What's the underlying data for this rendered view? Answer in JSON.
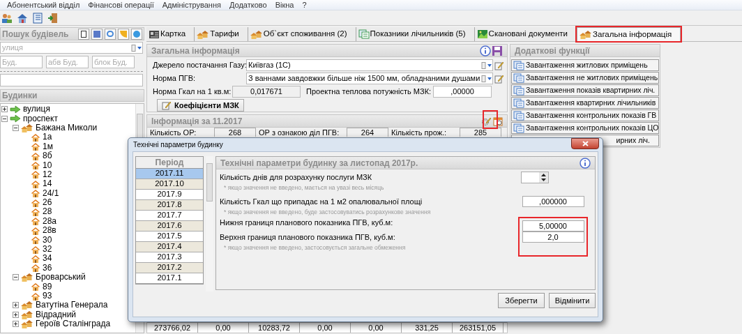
{
  "menu": [
    "Абонентський відділ",
    "Фінансові операції",
    "Адміністрування",
    "Додатково",
    "Вікна",
    "?"
  ],
  "search_panel": {
    "title": "Пошук будівель",
    "street": {
      "placeholder": "улиця"
    },
    "fields": [
      {
        "placeholder": "Буд."
      },
      {
        "placeholder": "абв Буд."
      },
      {
        "placeholder": "блок Буд."
      }
    ],
    "tree_title": "Будинки",
    "tree": [
      {
        "label": "вулиця",
        "kind": "street",
        "expanded": false
      },
      {
        "label": "проспект",
        "kind": "street",
        "expanded": true,
        "children": [
          {
            "label": "Бажана Миколи",
            "kind": "group",
            "expanded": true,
            "children": [
              {
                "label": "1а",
                "kind": "house"
              },
              {
                "label": "1м",
                "kind": "house"
              },
              {
                "label": "8б",
                "kind": "house"
              },
              {
                "label": "10",
                "kind": "house"
              },
              {
                "label": "12",
                "kind": "house"
              },
              {
                "label": "14",
                "kind": "house"
              },
              {
                "label": "24/1",
                "kind": "house"
              },
              {
                "label": "26",
                "kind": "house"
              },
              {
                "label": "28",
                "kind": "house"
              },
              {
                "label": "28а",
                "kind": "house"
              },
              {
                "label": "28в",
                "kind": "house"
              },
              {
                "label": "30",
                "kind": "house"
              },
              {
                "label": "32",
                "kind": "house"
              },
              {
                "label": "34",
                "kind": "house"
              },
              {
                "label": "36",
                "kind": "house"
              }
            ]
          },
          {
            "label": "Броварський",
            "kind": "group",
            "expanded": true,
            "children": [
              {
                "label": "89",
                "kind": "house"
              },
              {
                "label": "93",
                "kind": "house"
              }
            ]
          },
          {
            "label": "Ватутіна Генерала",
            "kind": "group",
            "expanded": false
          },
          {
            "label": "Відрадний",
            "kind": "group",
            "expanded": false
          },
          {
            "label": "Героїв Сталінграда",
            "kind": "group",
            "expanded": false
          }
        ]
      }
    ]
  },
  "tabs": [
    {
      "label": "Картка",
      "selected": false,
      "highlighted": false
    },
    {
      "label": "Тарифи",
      "selected": false,
      "highlighted": false
    },
    {
      "label": "Об`єкт споживання (2)",
      "selected": false,
      "highlighted": false
    },
    {
      "label": "Показники лічильників (5)",
      "selected": false,
      "highlighted": false
    },
    {
      "label": "Скановані документи",
      "selected": false,
      "highlighted": false
    },
    {
      "label": "Загальна інформація",
      "selected": true,
      "highlighted": true
    }
  ],
  "general_info": {
    "title": "Загальна інформація",
    "gas_source": {
      "label": "Джерело постачання Газу:",
      "value": "Київгаз (1С)"
    },
    "pgv_norm": {
      "label": "Норма ПГВ:",
      "value": "З ваннами завдовжки більше ніж 1500 мм, обладнаними душами"
    },
    "gcal_norm": {
      "label": "Норма Гкал на 1 кв.м:",
      "value": "0,017671"
    },
    "design_power": {
      "label": "Проектна теплова потужність МЗК:",
      "value": ",00000"
    },
    "button": "Коефіцієнти МЗК"
  },
  "period_info": {
    "title": "Інформація за 11.2017",
    "settings_highlighted": true,
    "row": [
      {
        "label": "Кількість ОР:",
        "value": "268"
      },
      {
        "label": "ОР з ознакою діл ПГВ:",
        "value": "264"
      },
      {
        "label": "Кількість прож.:",
        "value": "285"
      }
    ],
    "totals": [
      "273766,02",
      "0,00",
      "10283,72",
      "0,00",
      "0,00",
      "331,25",
      "263151,05"
    ]
  },
  "extra_functions": {
    "title": "Додаткові функції",
    "buttons": [
      "Завантаження житлових приміщень",
      "Завантаження не житлових приміщень",
      "Завантаження показів квартирних ліч.",
      "Завантаження квартирних лічильників",
      "Завантаження контрольних показів ГВ",
      "Завантаження контрольних показів ЦО",
      "ирних ліч."
    ]
  },
  "dialog": {
    "title": "Технічні параметри будинку",
    "periods_header": "Період",
    "periods": [
      {
        "label": "2017.11",
        "selected": true
      },
      {
        "label": "2017.10",
        "selected": false
      },
      {
        "label": "2017.9",
        "selected": false
      },
      {
        "label": "2017.8",
        "selected": false
      },
      {
        "label": "2017.7",
        "selected": false
      },
      {
        "label": "2017.6",
        "selected": false
      },
      {
        "label": "2017.5",
        "selected": false
      },
      {
        "label": "2017.4",
        "selected": false
      },
      {
        "label": "2017.3",
        "selected": false
      },
      {
        "label": "2017.2",
        "selected": false
      },
      {
        "label": "2017.1",
        "selected": false
      }
    ],
    "panel_title": "Технічні параметри будинку за листопад 2017р.",
    "params": [
      {
        "kind": "spinner",
        "label": "Кількість днів для розрахунку послуги МЗК",
        "hint": "* якщо значення не введено, мається на увазі весь місяць",
        "highlighted": false
      },
      {
        "kind": "input",
        "label": "Кількість Гкал що припадає на 1 м2 опалювальної площі",
        "value": ",000000",
        "hint": "* якщо значення не введено, буде застосовуватись розрахункове значення",
        "highlighted": false
      },
      {
        "kind": "input",
        "label": "Нижня границя планового показника ПГВ, куб.м:",
        "value": "5,00000",
        "highlighted": true
      },
      {
        "kind": "input",
        "label": "Верхня границя планового показника ПГВ, куб.м:",
        "value": "2,0",
        "hint": "* якщо значення не введено, застосовується загальне обмеження",
        "highlighted": true
      }
    ],
    "buttons": [
      "Зберегти",
      "Відмінити"
    ]
  }
}
